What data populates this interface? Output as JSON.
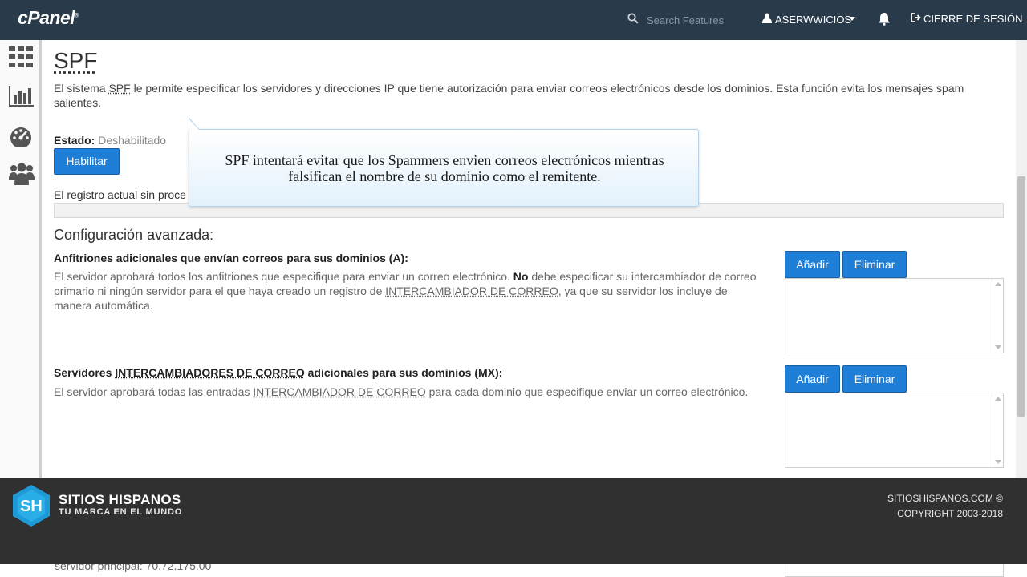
{
  "topbar": {
    "logo": "cPanel",
    "logo_mark": "®",
    "search_placeholder": "Search Features",
    "username": "ASERWWICIOS",
    "logout_label": "CIERRE DE SESIÓN"
  },
  "sidebar": {
    "items": [
      "grid-icon",
      "stats-icon",
      "dashboard-icon",
      "users-icon"
    ]
  },
  "page": {
    "title": "SPF",
    "desc_before": "El sistema ",
    "desc_abbr": "SPF",
    "desc_after": " le permite especificar los servidores y direcciones IP que tiene autorización para enviar correos electrónicos desde los dominios. Esta función evita los mensajes spam salientes.",
    "estado_label": "Estado:",
    "estado_value": "Deshabilitado",
    "habilitar_label": "Habilitar",
    "registro_text": "El registro actual sin proce",
    "config_heading": "Configuración avanzada:"
  },
  "sections": {
    "a": {
      "heading": "Anfitriones adicionales que envían correos para sus dominios (A):",
      "p1": "El servidor aprobará todos los anfitriones que especifique para enviar un correo electrónico. ",
      "p_bold": "No",
      "p2": " debe especificar su intercambiador de correo primario ni ningún servidor para el que haya creado un registro de ",
      "p_abbr": "INTERCAMBIADOR DE CORREO",
      "p3": ", ya que su servidor los incluye de manera automática.",
      "add_label": "Añadir",
      "del_label": "Eliminar"
    },
    "mx": {
      "heading_before": "Servidores ",
      "heading_abbr": "INTERCAMBIADORES DE CORREO",
      "heading_after": " adicionales para sus dominios (MX):",
      "p1": "El servidor aprobará todas las entradas ",
      "p_abbr": "INTERCAMBIADOR DE CORREO",
      "p2": " para cada dominio que especifique enviar un correo electrónico.",
      "add_label": "Añadir",
      "del_label": "Eliminar"
    }
  },
  "tooltip": {
    "text": "SPF intentará evitar que los Spammers envien correos electrónicos mientras falsifican el nombre de su dominio como el remitente."
  },
  "banner": {
    "title": "SITIOS HISPANOS",
    "subtitle": "TU MARCA EN EL MUNDO",
    "site": "SITIOSHISPANOS.COM ©",
    "copyright": "COPYRIGHT 2003-2018",
    "logo_letters": "SH"
  },
  "below": {
    "text": "servidor principal: 70.72.175.00"
  },
  "colors": {
    "topbar": "#293a4a",
    "primary_button": "#1f7ed6",
    "banner": "#303030",
    "tooltip_border": "#b5d3ec"
  }
}
